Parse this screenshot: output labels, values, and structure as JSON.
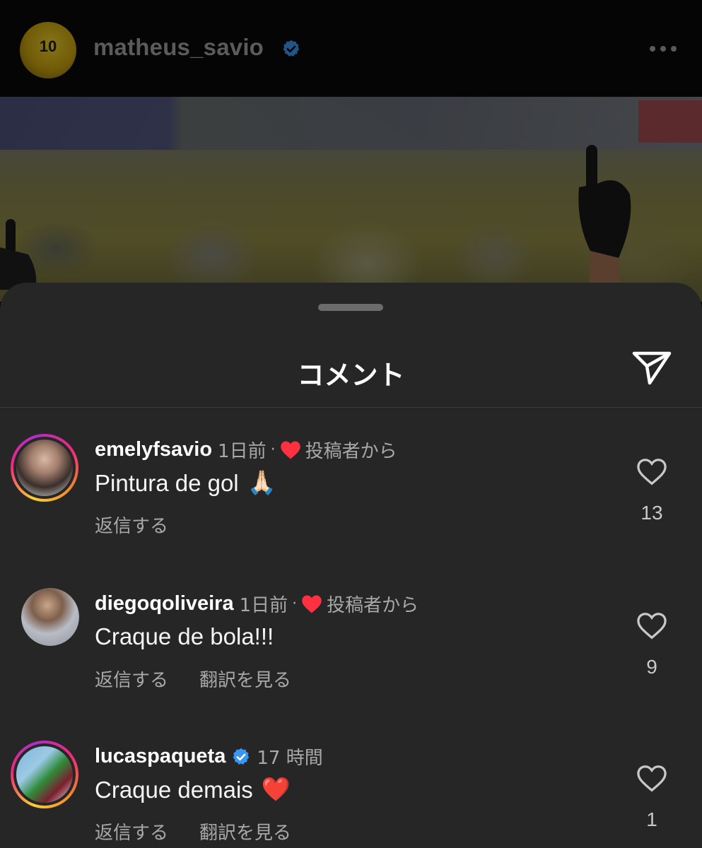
{
  "post": {
    "username": "matheus_savio",
    "avatar_jersey_number": "10",
    "more_label": "•••"
  },
  "sheet": {
    "title": "コメント"
  },
  "comments": [
    {
      "username": "emelyfsavio",
      "time": "1日前",
      "separator": "·",
      "from_author": "投稿者から",
      "text": "Pintura de gol",
      "emoji": "🙏🏻",
      "reply_label": "返信する",
      "likes": "13"
    },
    {
      "username": "diegoqoliveira",
      "time": "1日前",
      "separator": "·",
      "from_author": "投稿者から",
      "text": "Craque de bola!!!",
      "reply_label": "返信する",
      "translate_label": "翻訳を見る",
      "likes": "9"
    },
    {
      "username": "lucaspaqueta",
      "time": "17 時間",
      "text": "Craque demais",
      "emoji": "❤️",
      "reply_label": "返信する",
      "translate_label": "翻訳を見る",
      "likes": "1"
    }
  ],
  "colors": {
    "sheet_bg": "#262626",
    "verified_blue": "#3897f0",
    "like_red": "#ff3040",
    "secondary_text": "#a8a8a8"
  }
}
